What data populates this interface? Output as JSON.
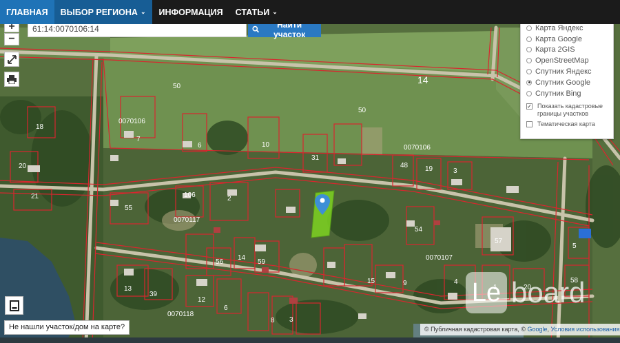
{
  "nav": {
    "items": [
      {
        "label": "ГЛАВНАЯ"
      },
      {
        "label": "ВЫБОР РЕГИОНА",
        "caret": "⌄"
      },
      {
        "label": "ИНФОРМАЦИЯ"
      },
      {
        "label": "СТАТЬИ",
        "caret": "⌄"
      }
    ]
  },
  "search": {
    "value": "61:14:0070106:14",
    "button_label": "Найти участок",
    "button_icon": "search-icon"
  },
  "controls": {
    "zoom_in": "+",
    "zoom_out": "−",
    "fullscreen_icon": "fullscreen-icon",
    "print_icon": "print-icon"
  },
  "layers": {
    "options": [
      {
        "label": "Карта Яндекс",
        "selected": false
      },
      {
        "label": "Карта Google",
        "selected": false
      },
      {
        "label": "Карта 2GIS",
        "selected": false
      },
      {
        "label": "OpenStreetMap",
        "selected": false
      },
      {
        "label": "Спутник Яндекс",
        "selected": false
      },
      {
        "label": "Спутник Google",
        "selected": true
      },
      {
        "label": "Спутник Bing",
        "selected": false
      }
    ],
    "show_boundaries": {
      "label": "Показать кадастровые границы участков",
      "checked": true
    },
    "thematic_map": {
      "label": "Тематическая карта",
      "checked": false
    }
  },
  "not_found_label": "Не нашли участок/дом на карте?",
  "attribution": {
    "prefix": "© Публичная кадастровая карта, © ",
    "google": "Google",
    "sep": ", ",
    "terms": "Условия использования"
  },
  "watermark": {
    "logo": "Le",
    "text": "board"
  },
  "map": {
    "road_label": "14",
    "labels": [
      {
        "text": "50"
      },
      {
        "text": "50"
      },
      {
        "text": "0070106"
      },
      {
        "text": "0070106"
      },
      {
        "text": "0070117"
      },
      {
        "text": "0070107"
      },
      {
        "text": "0070118"
      },
      {
        "text": "18"
      },
      {
        "text": "7"
      },
      {
        "text": "6"
      },
      {
        "text": "10"
      },
      {
        "text": "31"
      },
      {
        "text": "20"
      },
      {
        "text": "21"
      },
      {
        "text": "48"
      },
      {
        "text": "19"
      },
      {
        "text": "3"
      },
      {
        "text": "55"
      },
      {
        "text": "106"
      },
      {
        "text": "2"
      },
      {
        "text": "54"
      },
      {
        "text": "57"
      },
      {
        "text": "5"
      },
      {
        "text": "56"
      },
      {
        "text": "14"
      },
      {
        "text": "59"
      },
      {
        "text": "13"
      },
      {
        "text": "39"
      },
      {
        "text": "12"
      },
      {
        "text": "15"
      },
      {
        "text": "9"
      },
      {
        "text": "4"
      },
      {
        "text": "1"
      },
      {
        "text": "58"
      },
      {
        "text": "6"
      },
      {
        "text": "8"
      },
      {
        "text": "3"
      },
      {
        "text": "20"
      }
    ],
    "colors": {
      "boundary": "#d9262e",
      "parcel_fill": "#7ed321",
      "marker": "#3d8fd6"
    }
  }
}
